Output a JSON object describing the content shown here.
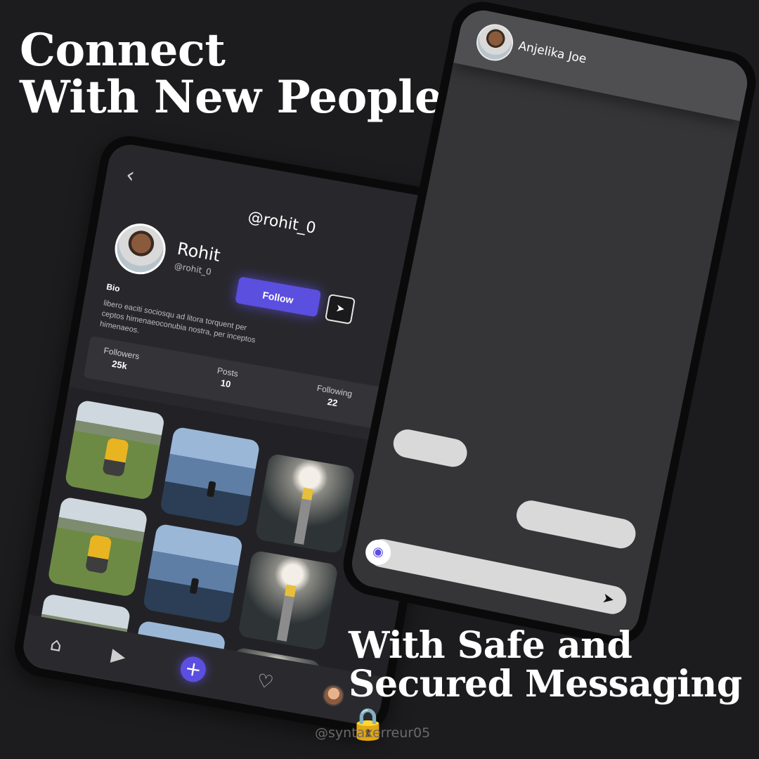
{
  "headline_top": [
    "Connect",
    "With New People"
  ],
  "headline_bottom": [
    "With Safe and",
    "Secured Messaging"
  ],
  "headline_bottom_emoji": "🔒",
  "watermark": "@syntaxerreur05",
  "profile": {
    "back_icon": "chevron-left-icon",
    "username_title": "@rohit_0",
    "name": "Rohit",
    "handle": "@rohit_0",
    "follow_label": "Follow",
    "send_icon": "send-icon",
    "menu_icon": "hamburger-menu-icon",
    "bio_label": "Bio",
    "bio_text": "libero eaciti sociosqu ad litora torquent per ceptos himenaeoconubia nostra, per inceptos himenaeos.",
    "stats": [
      {
        "label": "Followers",
        "value": "25k"
      },
      {
        "label": "Posts",
        "value": "10"
      },
      {
        "label": "Following",
        "value": "22"
      }
    ],
    "photos": [
      "hiker",
      "peak",
      "bridge",
      "hiker",
      "peak",
      "bridge",
      "hiker",
      "peak",
      "bridge"
    ],
    "nav": [
      "home-icon",
      "play-icon",
      "plus-icon",
      "heart-icon",
      "profile-avatar"
    ],
    "accent_color": "#5b4fe0"
  },
  "chat": {
    "contact_name": "Anjelika Joe",
    "camera_icon": "camera-icon",
    "send_icon": "send-icon"
  }
}
